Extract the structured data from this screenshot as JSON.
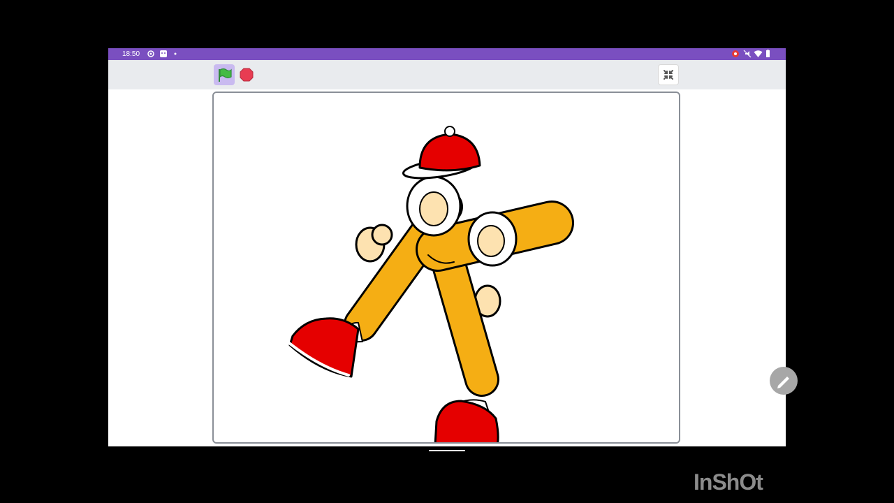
{
  "statusbar": {
    "time": "18:50",
    "left_icons": [
      "gps-icon",
      "face-icon",
      "dot-icon"
    ],
    "right_icons": [
      "record-icon",
      "mute-icon",
      "wifi-icon",
      "battery-icon"
    ]
  },
  "toolbar": {
    "green_flag_icon": "green-flag-icon",
    "stop_icon": "stop-icon",
    "fullscreen_exit_icon": "exit-fullscreen-icon"
  },
  "stage": {
    "sprite": "letter-k-character",
    "colors": {
      "body": "#f5ae14",
      "cap": "#e50000",
      "shoe": "#e50000",
      "hand": "#fde2b0"
    }
  },
  "edit_fab_icon": "pencil-icon",
  "watermark": "InShOt"
}
